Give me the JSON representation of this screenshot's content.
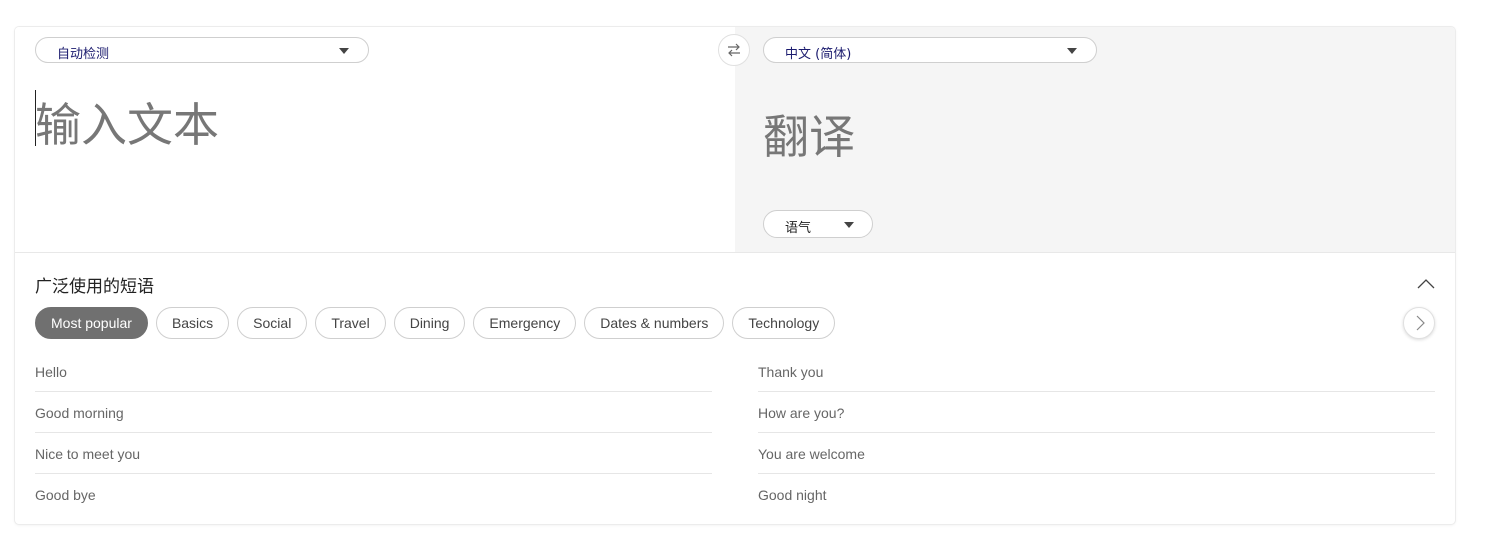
{
  "source": {
    "language": "自动检测",
    "placeholder": "输入文本"
  },
  "target": {
    "language": "中文 (简体)",
    "output_placeholder": "翻译",
    "tone_label": "语气"
  },
  "icons": {
    "swap": "swap-arrows-icon",
    "caret": "triangle-down-icon",
    "collapse": "chevron-up-icon",
    "next": "chevron-right-icon"
  },
  "phrases": {
    "title": "广泛使用的短语",
    "categories": [
      "Most popular",
      "Basics",
      "Social",
      "Travel",
      "Dining",
      "Emergency",
      "Dates & numbers",
      "Technology"
    ],
    "active_category": "Most popular",
    "left": [
      "Hello",
      "Good morning",
      "Nice to meet you",
      "Good bye"
    ],
    "right": [
      "Thank you",
      "How are you?",
      "You are welcome",
      "Good night"
    ]
  }
}
